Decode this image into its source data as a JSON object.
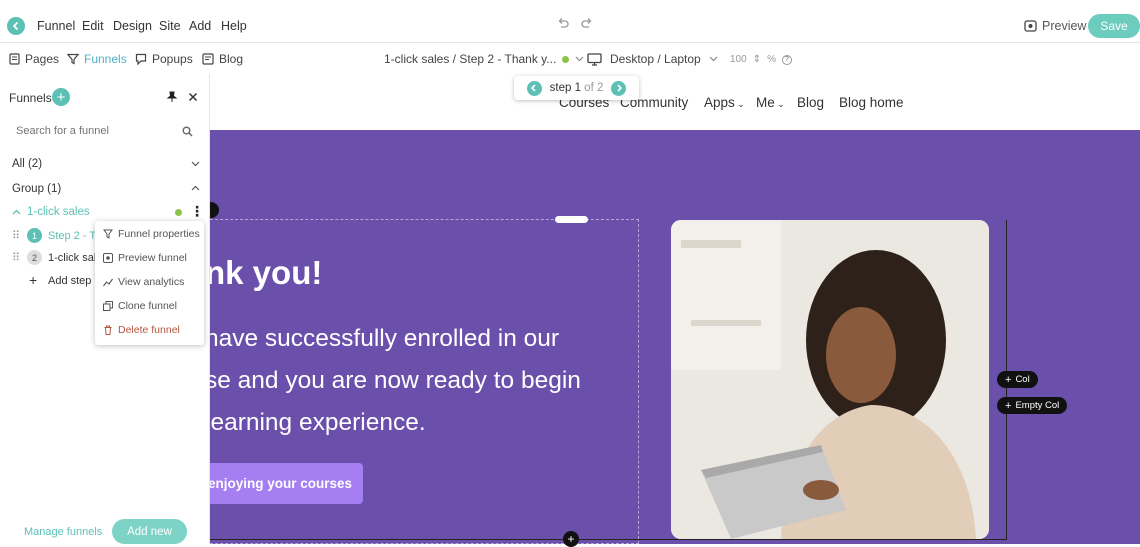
{
  "menu": [
    "Funnel",
    "Edit",
    "Design",
    "Site",
    "Add",
    "Help"
  ],
  "topbar": {
    "preview_label": "Preview",
    "save_label": "Save"
  },
  "tabs": [
    {
      "label": "Pages",
      "icon": "page-icon"
    },
    {
      "label": "Funnels",
      "icon": "funnel-icon"
    },
    {
      "label": "Popups",
      "icon": "popup-icon"
    },
    {
      "label": "Blog",
      "icon": "blog-icon"
    }
  ],
  "breadcrumb": "1-click sales / Step 2 - Thank y...",
  "device": "Desktop / Laptop",
  "zoom": {
    "value": "100",
    "unit": "%"
  },
  "step_pill": {
    "step": "step 1",
    "of": "of 2"
  },
  "site_nav": [
    "Courses",
    "Community",
    "Apps",
    "Me",
    "Blog",
    "Blog home"
  ],
  "hero": {
    "heading": "nk you!",
    "body": "have successfully enrolled in our se and you are now ready to begin learning experience.",
    "line1": "have successfully enrolled in our",
    "line2": "se and you are now ready to begin",
    "line3": "learning experience.",
    "cta": "enjoying your courses"
  },
  "col_buttons": {
    "col": "Col",
    "empty_col": "Empty Col"
  },
  "sidebar": {
    "title": "Funnels",
    "search_placeholder": "Search for a funnel",
    "all": "All (2)",
    "group": "Group (1)",
    "funnel_name": "1-click sales",
    "steps": [
      {
        "num": "1",
        "label": "Step 2 - Th"
      },
      {
        "num": "2",
        "label": "1-click sal"
      }
    ],
    "add_step": "Add step l",
    "manage": "Manage funnels",
    "add_new": "Add new"
  },
  "context_menu": [
    "Funnel properties",
    "Preview funnel",
    "View analytics",
    "Clone funnel",
    "Delete funnel"
  ],
  "colors": {
    "accent": "#5cc0b5",
    "hero_bg": "#6a4fab",
    "cta": "#a57ef2",
    "status": "#8bc34a"
  }
}
